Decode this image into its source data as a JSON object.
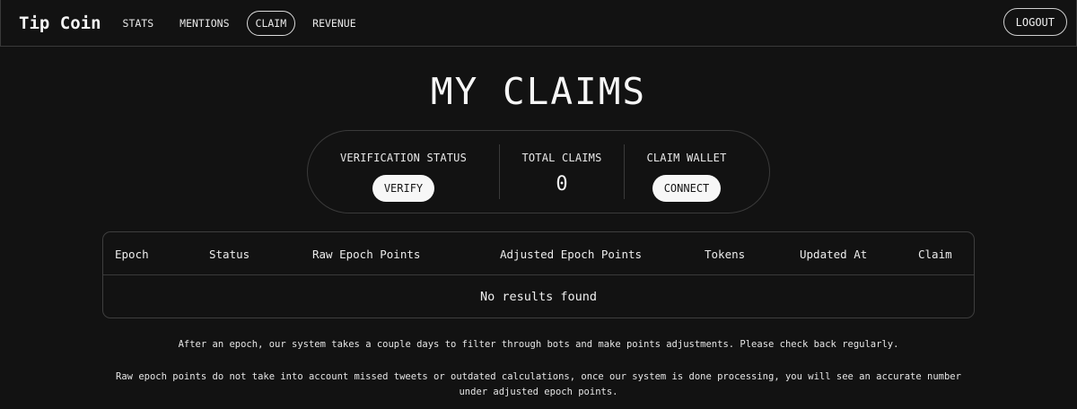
{
  "header": {
    "brand": "Tip Coin",
    "nav": [
      {
        "label": "STATS"
      },
      {
        "label": "MENTIONS"
      },
      {
        "label": "CLAIM"
      },
      {
        "label": "REVENUE"
      }
    ],
    "active_nav": "CLAIM",
    "logout_label": "LOGOUT"
  },
  "page": {
    "title": "MY CLAIMS"
  },
  "stats": {
    "verification": {
      "label": "VERIFICATION STATUS",
      "button": "VERIFY"
    },
    "total": {
      "label": "TOTAL CLAIMS",
      "value": "0"
    },
    "wallet": {
      "label": "CLAIM WALLET",
      "button": "CONNECT"
    }
  },
  "table": {
    "columns": [
      "Epoch",
      "Status",
      "Raw Epoch Points",
      "Adjusted Epoch Points",
      "Tokens",
      "Updated At",
      "Claim"
    ],
    "rows": [],
    "empty_message": "No results found"
  },
  "notes": [
    "After an epoch, our system takes a couple days to filter through bots and make points adjustments. Please check back regularly.",
    "Raw epoch points do not take into account missed tweets or outdated calculations, once our system is done processing, you will see an accurate number under adjusted epoch points."
  ],
  "colors": {
    "background": "#121212",
    "text": "#f2f2f2",
    "border": "#3a3a3a",
    "button_bg": "#f7f7f7",
    "button_text": "#161616"
  }
}
